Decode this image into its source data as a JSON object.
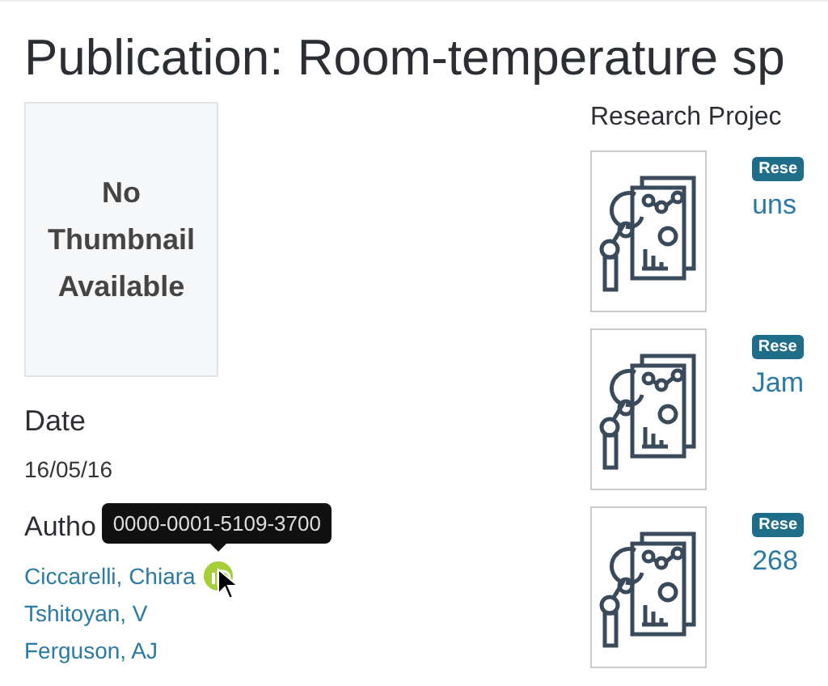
{
  "page_title": "Publication: Room-temperature sp",
  "thumbnail": {
    "text": "No Thumbnail Available"
  },
  "date": {
    "label": "Date",
    "value": "16/05/16"
  },
  "authors": {
    "label": "Autho",
    "items": [
      {
        "name": "Ciccarelli, Chiara",
        "orcid": true
      },
      {
        "name": "Tshitoyan, V",
        "orcid": false
      },
      {
        "name": "Ferguson, AJ",
        "orcid": false
      }
    ]
  },
  "tooltip": "0000-0001-5109-3700",
  "research_projects": {
    "label": "Research Projec",
    "items": [
      {
        "badge": "Rese",
        "title": "uns"
      },
      {
        "badge": "Rese",
        "title": "Jam"
      },
      {
        "badge": "Rese",
        "title": "268"
      }
    ]
  }
}
